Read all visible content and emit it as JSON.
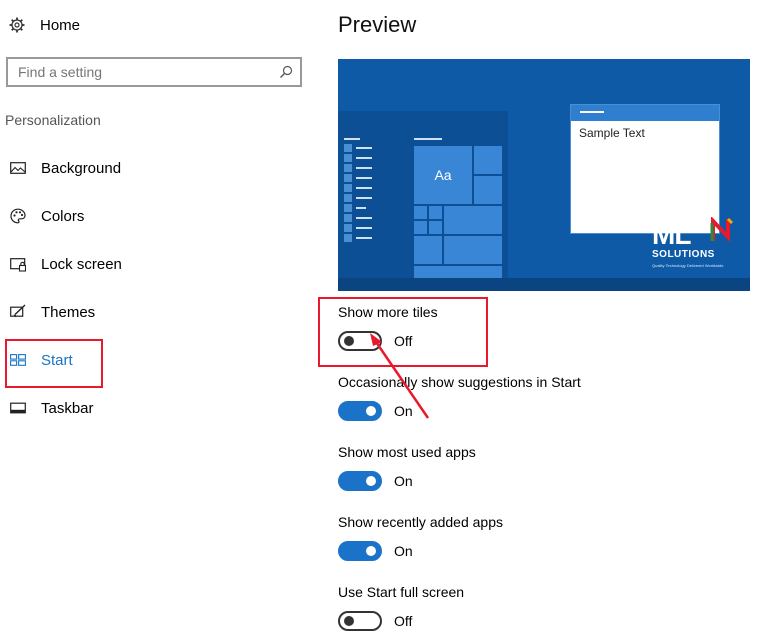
{
  "sidebar": {
    "home": {
      "label": "Home",
      "icon": "gear-icon"
    },
    "search": {
      "placeholder": "Find a setting",
      "value": "",
      "icon": "search-icon"
    },
    "section_label": "Personalization",
    "items": [
      {
        "label": "Background",
        "icon": "picture-icon",
        "active": false
      },
      {
        "label": "Colors",
        "icon": "palette-icon",
        "active": false
      },
      {
        "label": "Lock screen",
        "icon": "lock-screen-icon",
        "active": false
      },
      {
        "label": "Themes",
        "icon": "brush-icon",
        "active": false
      },
      {
        "label": "Start",
        "icon": "start-tiles-icon",
        "active": true
      },
      {
        "label": "Taskbar",
        "icon": "taskbar-icon",
        "active": false
      }
    ]
  },
  "main": {
    "title": "Preview",
    "preview": {
      "tile_label": "Aa",
      "window_text": "Sample Text",
      "logo_mark": "ML",
      "logo_name": "SOLUTIONS",
      "logo_tagline": "Quality Technology Delivered Worldwide"
    },
    "settings": [
      {
        "title": "Show more tiles",
        "state": "Off",
        "on": false
      },
      {
        "title": "Occasionally show suggestions in Start",
        "state": "On",
        "on": true
      },
      {
        "title": "Show most used apps",
        "state": "On",
        "on": true
      },
      {
        "title": "Show recently added apps",
        "state": "On",
        "on": true
      },
      {
        "title": "Use Start full screen",
        "state": "Off",
        "on": false
      }
    ]
  },
  "colors": {
    "accent": "#1a73c8",
    "highlight_box": "#e8192c",
    "preview_bg": "#0f5aa6"
  }
}
